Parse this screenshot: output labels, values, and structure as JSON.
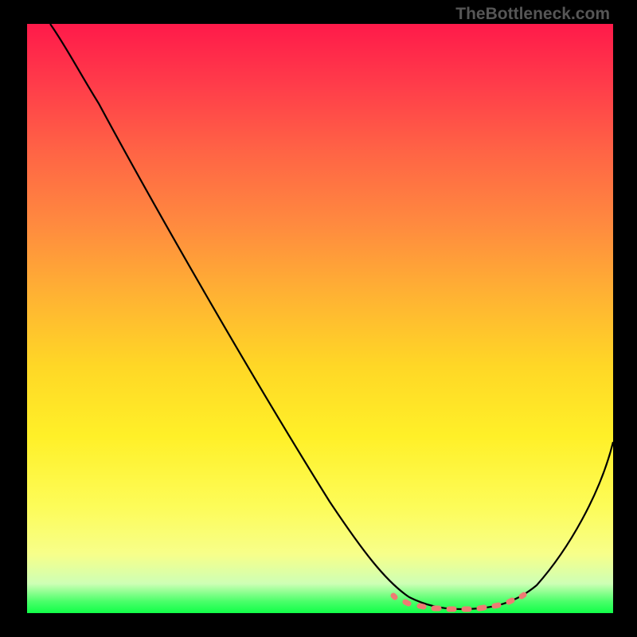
{
  "watermark": "TheBottleneck.com",
  "chart_data": {
    "type": "line",
    "title": "",
    "xlabel": "",
    "ylabel": "",
    "xlim": [
      0,
      100
    ],
    "ylim": [
      0,
      100
    ],
    "grid": false,
    "legend": false,
    "background_gradient": [
      "#ff1a4a",
      "#ff6545",
      "#ffb233",
      "#fff028",
      "#f7ff8a",
      "#11ff48"
    ],
    "series": [
      {
        "name": "bottleneck-curve",
        "color": "#000000",
        "x": [
          4,
          8,
          15,
          25,
          35,
          45,
          55,
          60,
          65,
          70,
          75,
          80,
          85,
          90,
          100
        ],
        "y": [
          100,
          95,
          85,
          69,
          53,
          37,
          21,
          13,
          6,
          2,
          0.5,
          0.5,
          2,
          8,
          29
        ]
      },
      {
        "name": "optimal-flat-region",
        "color": "#ee7b73",
        "style": "thick-dotted",
        "x": [
          63,
          67,
          70,
          73,
          76,
          80,
          83,
          85
        ],
        "y": [
          3,
          1.5,
          0.8,
          0.6,
          0.6,
          0.8,
          1.5,
          3
        ]
      }
    ]
  }
}
